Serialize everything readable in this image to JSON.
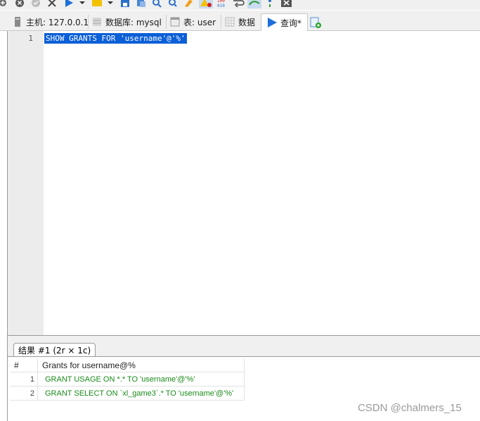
{
  "tabs": [
    {
      "label": "主机: 127.0.0.1",
      "icon": "server-icon"
    },
    {
      "label": "数据库: mysql",
      "icon": "database-icon"
    },
    {
      "label": "表: user",
      "icon": "table-icon"
    },
    {
      "label": "数据",
      "icon": "data-grid-icon"
    },
    {
      "label": "查询*",
      "icon": "play-icon",
      "active": true
    }
  ],
  "editor": {
    "line_number": "1",
    "code": "SHOW GRANTS FOR 'username'@'%'"
  },
  "result": {
    "tab_label": "结果 #1 (2r × 1c)",
    "columns": [
      "#",
      "Grants for username@%"
    ],
    "rows": [
      {
        "num": "1",
        "value": "GRANT USAGE ON *.* TO 'username'@'%'"
      },
      {
        "num": "2",
        "value": "GRANT SELECT ON `xl_game3`.* TO 'username'@'%'"
      }
    ]
  },
  "watermark": "CSDN @chalmers_15",
  "colors": {
    "selection": "#0b5fd7",
    "result_text": "#1a8a1a",
    "accent_blue": "#1e6fd9"
  }
}
